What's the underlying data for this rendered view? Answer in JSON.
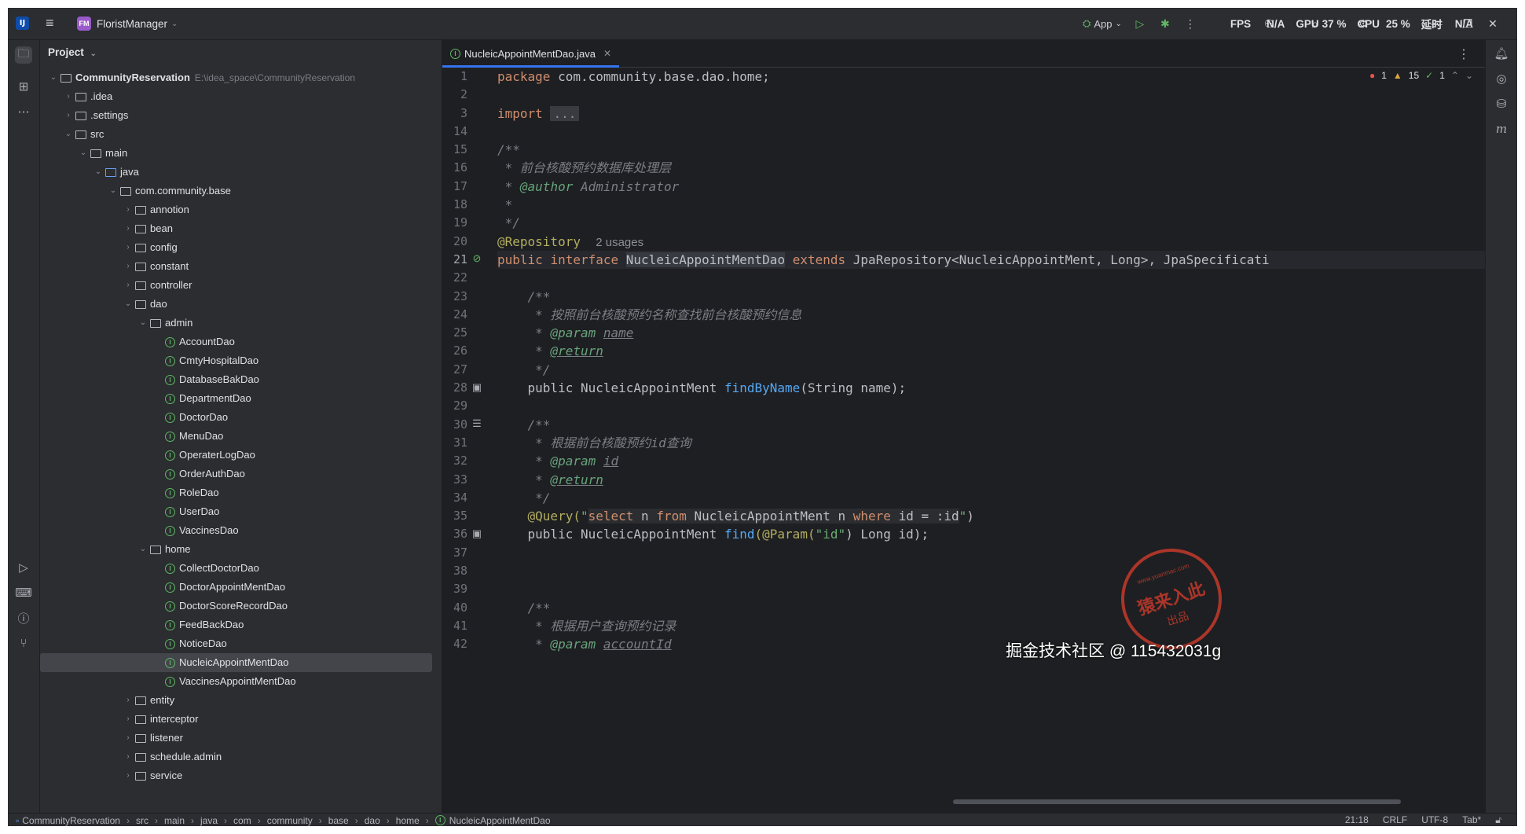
{
  "titlebar": {
    "logo": "IJ",
    "project_badge": "FM",
    "project_name": "FloristManager",
    "run_config": "App",
    "fps_label": "FPS",
    "fps_value": "N/A",
    "gpu_label": "GPU",
    "gpu_value": "37 %",
    "cpu_label": "CPU",
    "cpu_value": "25 %",
    "latency_label": "延时",
    "latency_value": "N/A"
  },
  "project_panel": {
    "title": "Project",
    "root_name": "CommunityReservation",
    "root_path": "E:\\idea_space\\CommunityReservation",
    "items": [
      {
        "label": ".idea",
        "depth": 1,
        "type": "folder",
        "expanded": false
      },
      {
        "label": ".settings",
        "depth": 1,
        "type": "folder",
        "expanded": false
      },
      {
        "label": "src",
        "depth": 1,
        "type": "folder",
        "expanded": true
      },
      {
        "label": "main",
        "depth": 2,
        "type": "folder",
        "expanded": true
      },
      {
        "label": "java",
        "depth": 3,
        "type": "src-folder",
        "expanded": true
      },
      {
        "label": "com.community.base",
        "depth": 4,
        "type": "package",
        "expanded": true
      },
      {
        "label": "annotion",
        "depth": 5,
        "type": "package",
        "expanded": false
      },
      {
        "label": "bean",
        "depth": 5,
        "type": "package",
        "expanded": false
      },
      {
        "label": "config",
        "depth": 5,
        "type": "package",
        "expanded": false
      },
      {
        "label": "constant",
        "depth": 5,
        "type": "package",
        "expanded": false
      },
      {
        "label": "controller",
        "depth": 5,
        "type": "package",
        "expanded": false
      },
      {
        "label": "dao",
        "depth": 5,
        "type": "package",
        "expanded": true
      },
      {
        "label": "admin",
        "depth": 6,
        "type": "package",
        "expanded": true
      },
      {
        "label": "AccountDao",
        "depth": 7,
        "type": "interface"
      },
      {
        "label": "CmtyHospitalDao",
        "depth": 7,
        "type": "interface"
      },
      {
        "label": "DatabaseBakDao",
        "depth": 7,
        "type": "interface"
      },
      {
        "label": "DepartmentDao",
        "depth": 7,
        "type": "interface"
      },
      {
        "label": "DoctorDao",
        "depth": 7,
        "type": "interface"
      },
      {
        "label": "MenuDao",
        "depth": 7,
        "type": "interface"
      },
      {
        "label": "OperaterLogDao",
        "depth": 7,
        "type": "interface"
      },
      {
        "label": "OrderAuthDao",
        "depth": 7,
        "type": "interface"
      },
      {
        "label": "RoleDao",
        "depth": 7,
        "type": "interface"
      },
      {
        "label": "UserDao",
        "depth": 7,
        "type": "interface"
      },
      {
        "label": "VaccinesDao",
        "depth": 7,
        "type": "interface"
      },
      {
        "label": "home",
        "depth": 6,
        "type": "package",
        "expanded": true
      },
      {
        "label": "CollectDoctorDao",
        "depth": 7,
        "type": "interface"
      },
      {
        "label": "DoctorAppointMentDao",
        "depth": 7,
        "type": "interface"
      },
      {
        "label": "DoctorScoreRecordDao",
        "depth": 7,
        "type": "interface"
      },
      {
        "label": "FeedBackDao",
        "depth": 7,
        "type": "interface"
      },
      {
        "label": "NoticeDao",
        "depth": 7,
        "type": "interface"
      },
      {
        "label": "NucleicAppointMentDao",
        "depth": 7,
        "type": "interface",
        "selected": true
      },
      {
        "label": "VaccinesAppointMentDao",
        "depth": 7,
        "type": "interface"
      },
      {
        "label": "entity",
        "depth": 5,
        "type": "package",
        "expanded": false
      },
      {
        "label": "interceptor",
        "depth": 5,
        "type": "package",
        "expanded": false
      },
      {
        "label": "listener",
        "depth": 5,
        "type": "package",
        "expanded": false
      },
      {
        "label": "schedule.admin",
        "depth": 5,
        "type": "package",
        "expanded": false
      },
      {
        "label": "service",
        "depth": 5,
        "type": "package",
        "expanded": false
      }
    ]
  },
  "editor": {
    "tab_label": "NucleicAppointMentDao.java",
    "inspections": {
      "errors": "1",
      "warnings": "15",
      "weak": "1"
    },
    "line_numbers": [
      "1",
      "2",
      "3",
      "14",
      "15",
      "16",
      "17",
      "18",
      "19",
      "20",
      "21",
      "22",
      "23",
      "24",
      "25",
      "26",
      "27",
      "28",
      "29",
      "30",
      "31",
      "32",
      "33",
      "34",
      "35",
      "36",
      "37",
      "38",
      "39",
      "40",
      "41",
      "42"
    ],
    "lines": {
      "l1_kw": "package",
      "l1_rest": " com.community.base.dao.home;",
      "l3_kw": "import",
      "l3_fold": "...",
      "l15": "/**",
      "l16": " * 前台核酸预约数据库处理层",
      "l17_star": " * ",
      "l17_tag": "@author",
      "l17_rest": " Administrator",
      "l18": " *",
      "l19": " */",
      "l20_ann": "@Repository",
      "l20_hint": "2 usages",
      "l21_kw1": "public",
      "l21_kw2": "interface",
      "l21_name": "NucleicAppointMentDao",
      "l21_kw3": "extends",
      "l21_rest": " JpaRepository<NucleicAppointMent, Long>, JpaSpecificati",
      "l23": "    /**",
      "l24": "     * 按照前台核酸预约名称查找前台核酸预约信息",
      "l25_star": "     * ",
      "l25_tag": "@param",
      "l25_rest": "name",
      "l26_star": "     * ",
      "l26_tag": "@return",
      "l27": "     */",
      "l28_pre": "    public NucleicAppointMent ",
      "l28_fn": "findByName",
      "l28_rest": "(String name);",
      "l30": "    /**",
      "l31": "     * 根据前台核酸预约id查询",
      "l32_star": "     * ",
      "l32_tag": "@param",
      "l32_rest": "id",
      "l33_star": "     * ",
      "l33_tag": "@return",
      "l34": "     */",
      "l35_ann": "    @Query(",
      "l35_q1": "\"",
      "l35_s1": "select",
      "l35_s2": " n ",
      "l35_s3": "from",
      "l35_s4": " NucleicAppointMent n ",
      "l35_s5": "where",
      "l35_s6": " id = :id",
      "l35_q2": "\"",
      "l35_end": ")",
      "l36_pre": "    public NucleicAppointMent ",
      "l36_fn": "find",
      "l36_ann": "(@Param(",
      "l36_str": "\"id\"",
      "l36_rest": ") Long id);",
      "l40": "    /**",
      "l41": "     * 根据用户查询预约记录",
      "l42_star": "     * ",
      "l42_tag": "@param",
      "l42_rest": "accountId"
    }
  },
  "statusbar": {
    "breadcrumbs": [
      "CommunityReservation",
      "src",
      "main",
      "java",
      "com",
      "community",
      "base",
      "dao",
      "home",
      "NucleicAppointMentDao"
    ],
    "position": "21:18",
    "line_sep": "CRLF",
    "encoding": "UTF-8",
    "indent": "Tab*"
  },
  "watermark": {
    "stamp_top": "www.yuanmac.com",
    "stamp_main": "猿来入此",
    "stamp_bottom": "出品",
    "juejin": "掘金技术社区 @ 115432031g"
  },
  "colors": {
    "keyword": "#cf8e6d",
    "comment": "#7a7e85",
    "annotation": "#b3ae60",
    "function": "#56a8f5",
    "string": "#6aab73",
    "accent": "#3574f0"
  }
}
